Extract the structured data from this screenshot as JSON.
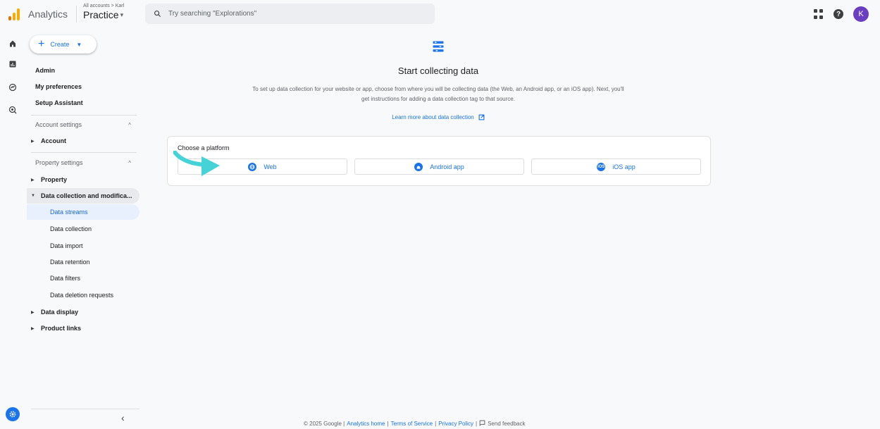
{
  "header": {
    "app_name": "Analytics",
    "account_path": "All accounts > Karl",
    "property_name": "Practice",
    "search_placeholder": "Try searching \"Explorations\"",
    "avatar_initial": "K",
    "colors": {
      "avatar": "#6a3ec2",
      "logo_orange": "#f9ab00",
      "logo_dark": "#e37400"
    }
  },
  "rail": {
    "icons": [
      "home-icon",
      "reports-icon",
      "explore-icon",
      "advertising-icon"
    ],
    "settings_icon": "gear-icon"
  },
  "sidebar": {
    "create_label": "Create",
    "top_items": [
      "Admin",
      "My preferences",
      "Setup Assistant"
    ],
    "account_section": "Account settings",
    "account_item": "Account",
    "property_section": "Property settings",
    "property_item": "Property",
    "data_collection_group": "Data collection and modifica...",
    "sub_items": [
      "Data streams",
      "Data collection",
      "Data import",
      "Data retention",
      "Data filters",
      "Data deletion requests"
    ],
    "active_sub_item": "Data streams",
    "data_display": "Data display",
    "product_links": "Product links"
  },
  "main": {
    "title": "Start collecting data",
    "description_line1": "To set up data collection for your website or app, choose from where you will be collecting data (the Web, an Android app, or an iOS app). Next, you'll",
    "description_line2": "get instructions for adding a data collection tag to that source.",
    "learn_more": "Learn more about data collection",
    "platform_title": "Choose a platform",
    "platforms": [
      {
        "label": "Web",
        "icon": "globe-icon"
      },
      {
        "label": "Android app",
        "icon": "android-icon"
      },
      {
        "label": "iOS app",
        "icon": "ios-icon"
      }
    ],
    "accent_color": "#1a73e8",
    "arrow_color": "#45d3d8"
  },
  "footer": {
    "copyright": "© 2025 Google |",
    "analytics_home": "Analytics home",
    "sep1": "|",
    "terms": "Terms of Service",
    "sep2": "|",
    "privacy": "Privacy Policy",
    "sep3": "|",
    "feedback": "Send feedback"
  }
}
